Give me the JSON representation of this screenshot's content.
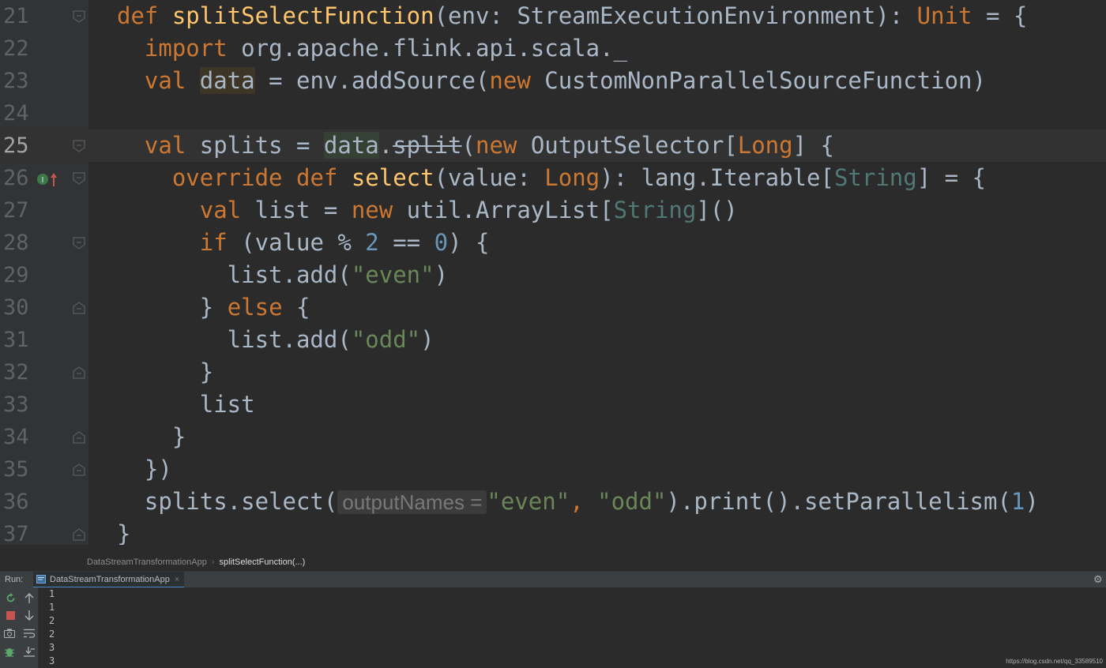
{
  "editor": {
    "lines": [
      {
        "num": "21",
        "current": false,
        "fold": "open",
        "tokens": [
          [
            "k",
            "def "
          ],
          [
            "fn",
            "splitSelectFunction"
          ],
          [
            "",
            "(env: StreamExecutionEnvironment): "
          ],
          [
            "k",
            "Unit"
          ],
          [
            "",
            " = {"
          ]
        ]
      },
      {
        "num": "22",
        "current": false,
        "fold": "",
        "tokens": [
          [
            "",
            "  "
          ],
          [
            "k",
            "import"
          ],
          [
            "",
            " org.apache.flink.api.scala._"
          ]
        ]
      },
      {
        "num": "23",
        "current": false,
        "fold": "",
        "tokens": [
          [
            "",
            "  "
          ],
          [
            "k",
            "val "
          ],
          [
            "hl-data2",
            "data"
          ],
          [
            "",
            " = env.addSource("
          ],
          [
            "k",
            "new "
          ],
          [
            "",
            "CustomNonParallelSourceFunction)"
          ]
        ]
      },
      {
        "num": "24",
        "current": false,
        "fold": "",
        "tokens": [
          [
            "",
            ""
          ]
        ]
      },
      {
        "num": "25",
        "current": true,
        "fold": "open",
        "tokens": [
          [
            "",
            "  "
          ],
          [
            "k",
            "val "
          ],
          [
            "",
            "splits = "
          ],
          [
            "hl-data",
            "data"
          ],
          [
            "",
            "."
          ],
          [
            "strike",
            "split"
          ],
          [
            "",
            "("
          ],
          [
            "k",
            "new "
          ],
          [
            "",
            "OutputSelector["
          ],
          [
            "k",
            "Long"
          ],
          [
            "",
            "] {"
          ]
        ]
      },
      {
        "num": "26",
        "current": false,
        "fold": "open",
        "override": true,
        "tokens": [
          [
            "",
            "    "
          ],
          [
            "k",
            "override def "
          ],
          [
            "fn",
            "select"
          ],
          [
            "",
            "(value: "
          ],
          [
            "k",
            "Long"
          ],
          [
            "",
            "): lang.Iterable["
          ],
          [
            "tp",
            "String"
          ],
          [
            "",
            "] = {"
          ]
        ]
      },
      {
        "num": "27",
        "current": false,
        "fold": "",
        "tokens": [
          [
            "",
            "      "
          ],
          [
            "k",
            "val "
          ],
          [
            "",
            "list = "
          ],
          [
            "k",
            "new "
          ],
          [
            "",
            "util.ArrayList["
          ],
          [
            "tp",
            "String"
          ],
          [
            "",
            "]()"
          ]
        ]
      },
      {
        "num": "28",
        "current": false,
        "fold": "open",
        "tokens": [
          [
            "",
            "      "
          ],
          [
            "k",
            "if "
          ],
          [
            "",
            "(value % "
          ],
          [
            "n",
            "2"
          ],
          [
            "",
            " == "
          ],
          [
            "n",
            "0"
          ],
          [
            "",
            ") {"
          ]
        ]
      },
      {
        "num": "29",
        "current": false,
        "fold": "",
        "tokens": [
          [
            "",
            "        list.add("
          ],
          [
            "s",
            "\"even\""
          ],
          [
            "",
            ")"
          ]
        ]
      },
      {
        "num": "30",
        "current": false,
        "fold": "close",
        "tokens": [
          [
            "",
            "      } "
          ],
          [
            "k",
            "else "
          ],
          [
            "",
            "{"
          ]
        ]
      },
      {
        "num": "31",
        "current": false,
        "fold": "",
        "tokens": [
          [
            "",
            "        list.add("
          ],
          [
            "s",
            "\"odd\""
          ],
          [
            "",
            ")"
          ]
        ]
      },
      {
        "num": "32",
        "current": false,
        "fold": "close",
        "tokens": [
          [
            "",
            "      }"
          ]
        ]
      },
      {
        "num": "33",
        "current": false,
        "fold": "",
        "tokens": [
          [
            "",
            "      list"
          ]
        ]
      },
      {
        "num": "34",
        "current": false,
        "fold": "close",
        "tokens": [
          [
            "",
            "    }"
          ]
        ]
      },
      {
        "num": "35",
        "current": false,
        "fold": "close",
        "tokens": [
          [
            "",
            "  })"
          ]
        ]
      },
      {
        "num": "36",
        "current": false,
        "fold": "",
        "tokens": [
          [
            "",
            "  splits.select("
          ],
          [
            "hint",
            "outputNames ="
          ],
          [
            "s",
            "\"even\""
          ],
          [
            "k",
            ", "
          ],
          [
            "s",
            "\"odd\""
          ],
          [
            "",
            ").print().setParallelism("
          ],
          [
            "n",
            "1"
          ],
          [
            "",
            ")"
          ]
        ]
      },
      {
        "num": "37",
        "current": false,
        "fold": "close",
        "tokens": [
          [
            "",
            "}"
          ]
        ]
      }
    ]
  },
  "breadcrumb": {
    "items": [
      "DataStreamTransformationApp",
      "splitSelectFunction(...)"
    ]
  },
  "run_panel": {
    "label": "Run:",
    "tab_title": "DataStreamTransformationApp",
    "tab_close": "×",
    "console_lines": [
      "1",
      "1",
      "2",
      "2",
      "3",
      "3"
    ]
  },
  "watermark": "https://blog.csdn.net/qq_33589510",
  "colors": {
    "keyword": "#cc7832",
    "function": "#ffc66d",
    "string": "#6a8759",
    "number": "#6897bb",
    "background": "#2b2b2b",
    "gutter": "#313335"
  },
  "icons": {
    "fold_open": "fold-open-icon",
    "fold_close": "fold-close-icon",
    "override": "override-method-icon",
    "rerun": "rerun-icon",
    "stop": "stop-icon",
    "camera": "dump-threads-icon",
    "up": "scroll-up-icon",
    "down": "scroll-down-icon",
    "wrap": "soft-wrap-icon",
    "scroll_end": "scroll-to-end-icon",
    "gear": "gear-icon",
    "bug": "debug-icon"
  }
}
